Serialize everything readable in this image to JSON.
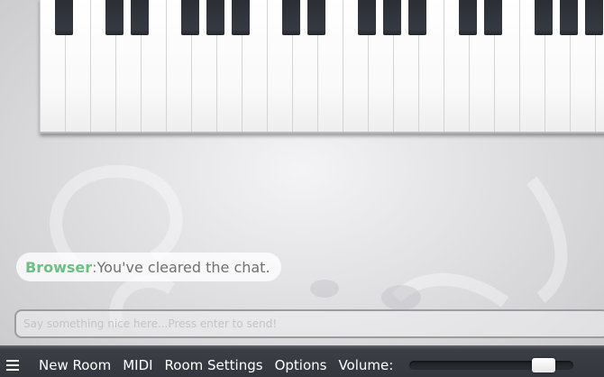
{
  "chat": {
    "messages": [
      {
        "name": "Browser",
        "separator": ":",
        "text": " You've cleared the chat."
      }
    ],
    "input_placeholder": "Say something nice here...Press enter to send!"
  },
  "bottom_bar": {
    "items": [
      "New Room",
      "MIDI",
      "Room Settings",
      "Options"
    ],
    "volume_label": "Volume:",
    "volume_level": 0.87
  },
  "colors": {
    "chat_name": "#6fbf85",
    "bar_background": "#34383e",
    "black_key": "#2a2e34"
  },
  "icons": {
    "menu": "hamburger-menu-icon"
  }
}
